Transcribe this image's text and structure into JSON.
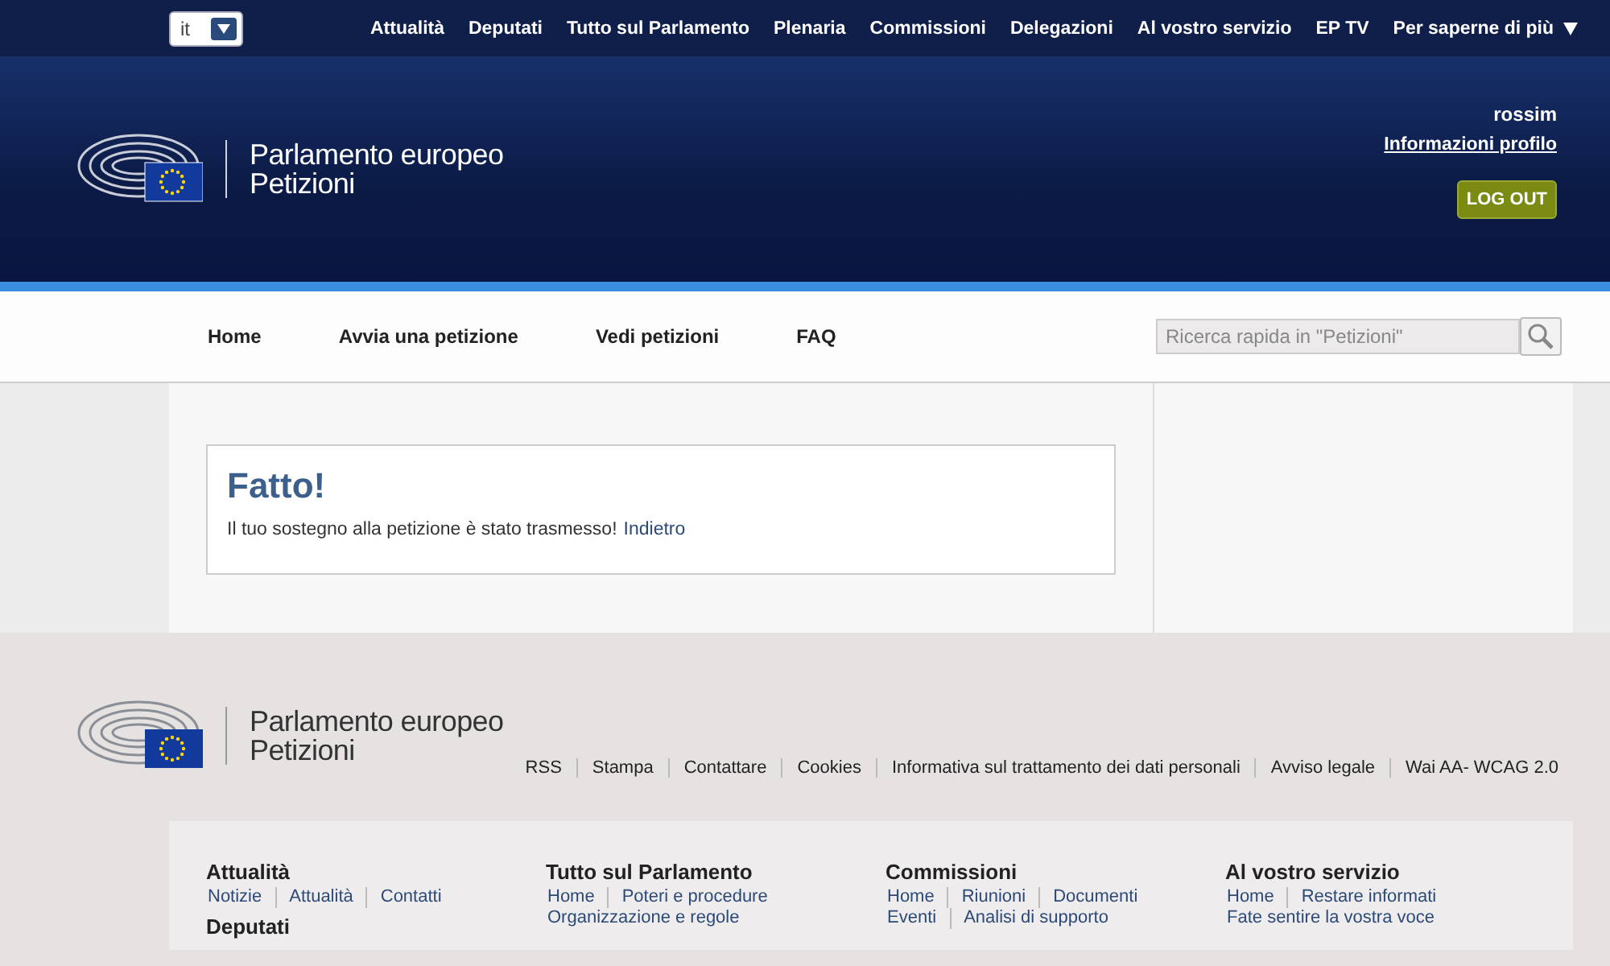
{
  "top_bar": {
    "language": "it",
    "menu": [
      "Attualità",
      "Deputati",
      "Tutto sul Parlamento",
      "Plenaria",
      "Commissioni",
      "Delegazioni",
      "Al vostro servizio",
      "EP TV",
      "Per saperne di più"
    ]
  },
  "header": {
    "logo_lines": [
      "Parlamento europeo",
      "Petizioni"
    ],
    "user": "rossim",
    "profile_link": "Informazioni profilo",
    "logout": "LOG OUT"
  },
  "nav": {
    "items": [
      "Home",
      "Avvia una petizione",
      "Vedi petizioni",
      "FAQ"
    ],
    "search": {
      "placeholder": "Ricerca rapida in \"Petizioni\""
    }
  },
  "message": {
    "title": "Fatto!",
    "text": "Il tuo sostegno alla petizione è stato trasmesso!",
    "link": "Indietro"
  },
  "footer": {
    "logo_lines": [
      "Parlamento europeo",
      "Petizioni"
    ],
    "links": [
      "RSS",
      "Stampa",
      "Contattare",
      "Cookies",
      "Informativa sul trattamento dei dati personali",
      "Avviso legale",
      "Wai AA- WCAG 2.0"
    ],
    "columns": [
      [
        {
          "title": "Attualità",
          "rows": [
            [
              "Notizie",
              "Attualità",
              "Contatti"
            ]
          ]
        },
        {
          "title": "Deputati"
        }
      ],
      [
        {
          "title": "Tutto sul Parlamento",
          "rows": [
            [
              "Home",
              "Poteri e procedure"
            ],
            [
              "Organizzazione e regole"
            ]
          ]
        }
      ],
      [
        {
          "title": "Commissioni",
          "rows": [
            [
              "Home",
              "Riunioni",
              "Documenti"
            ],
            [
              "Eventi",
              "Analisi di supporto"
            ]
          ]
        }
      ],
      [
        {
          "title": "Al vostro servizio",
          "rows": [
            [
              "Home",
              "Restare informati"
            ],
            [
              "Fate sentire la vostra voce"
            ]
          ]
        }
      ]
    ]
  }
}
